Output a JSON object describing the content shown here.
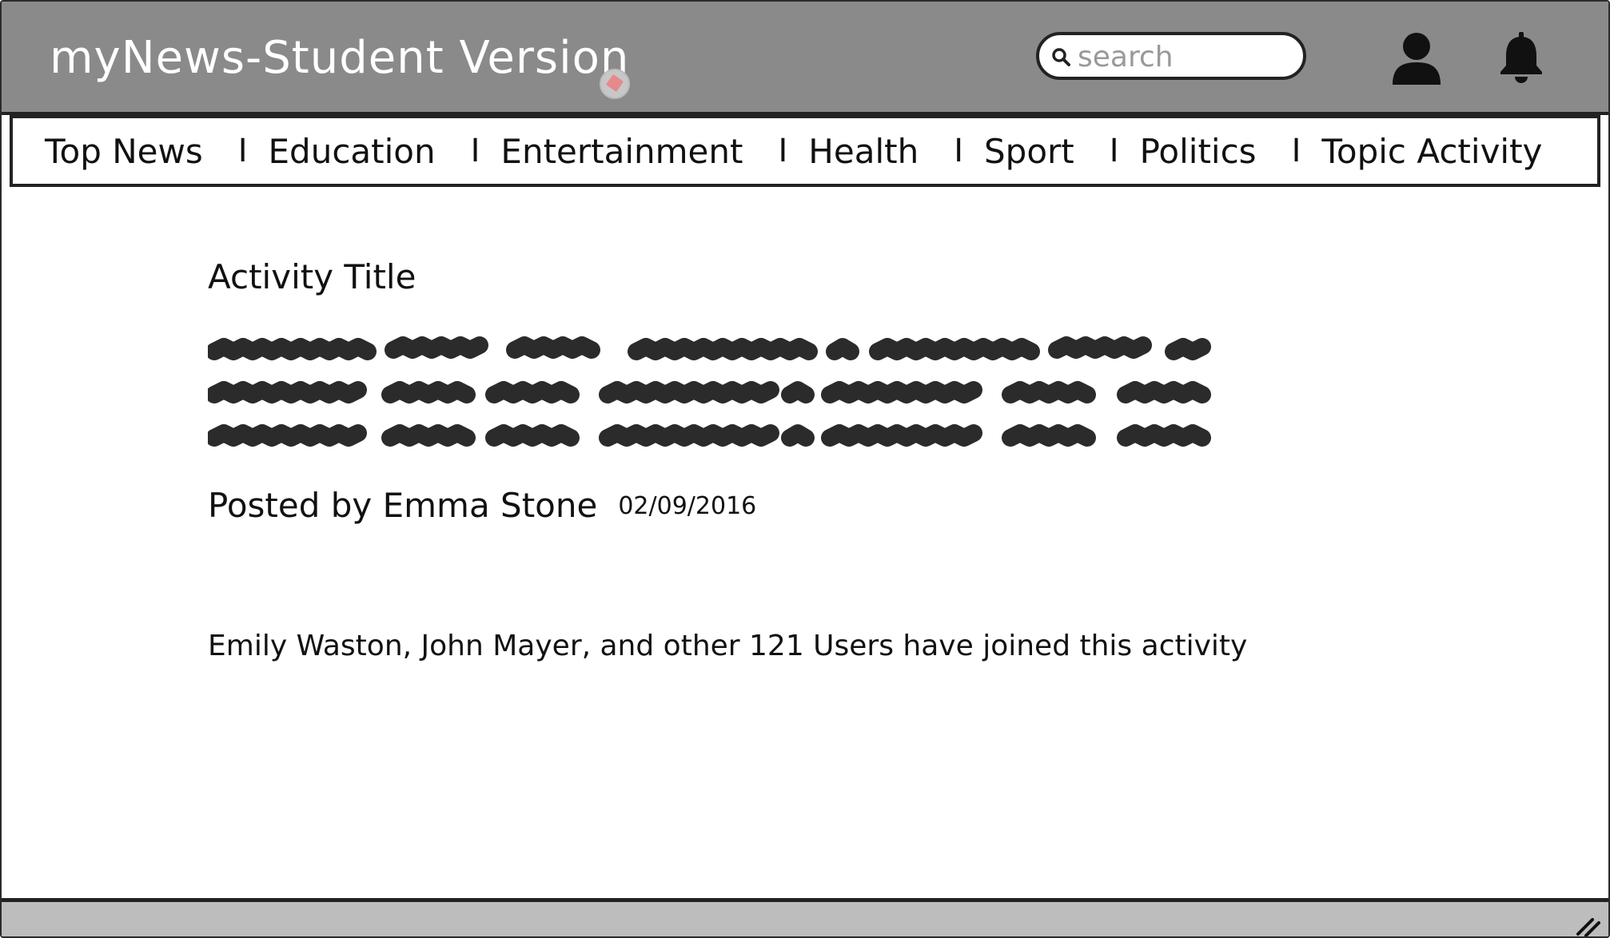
{
  "header": {
    "title": "myNews-Student Version",
    "search": {
      "placeholder": "search",
      "value": ""
    },
    "icons": {
      "search": "search-icon",
      "user": "user-icon",
      "bell": "bell-icon"
    },
    "background_color": "#8a8a8a"
  },
  "nav": {
    "items": [
      {
        "label": "Top News"
      },
      {
        "label": "Education"
      },
      {
        "label": "Entertainment"
      },
      {
        "label": "Health"
      },
      {
        "label": "Sport"
      },
      {
        "label": "Politics"
      },
      {
        "label": "Topic Activity"
      }
    ],
    "separator": "I"
  },
  "activity": {
    "title": "Activity Title",
    "posted_by": "Posted by Emma Stone",
    "date": "02/09/2016",
    "joined_text": "Emily Waston, John Mayer, and other 121 Users have joined this activity"
  }
}
